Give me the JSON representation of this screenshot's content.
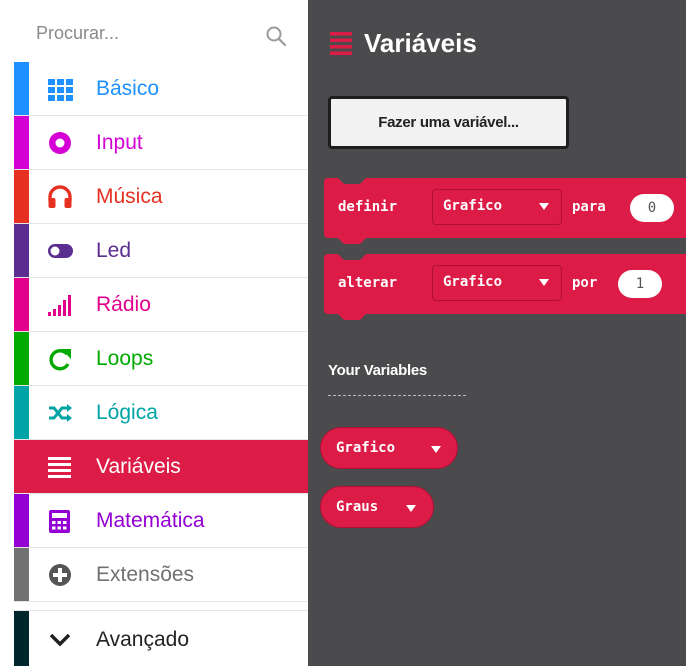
{
  "search": {
    "placeholder": "Procurar..."
  },
  "categories": [
    {
      "label": "Básico",
      "color": "#1e90ff",
      "icon": "grid-icon"
    },
    {
      "label": "Input",
      "color": "#d400d4",
      "icon": "target-icon"
    },
    {
      "label": "Música",
      "color": "#e63022",
      "icon": "headphones-icon"
    },
    {
      "label": "Led",
      "color": "#5c2d91",
      "icon": "toggle-icon"
    },
    {
      "label": "Rádio",
      "color": "#e3008c",
      "icon": "signal-icon"
    },
    {
      "label": "Loops",
      "color": "#00aa00",
      "icon": "loop-icon"
    },
    {
      "label": "Lógica",
      "color": "#00a4a6",
      "icon": "shuffle-icon"
    },
    {
      "label": "Variáveis",
      "color": "#dc143c",
      "icon": "lines-icon",
      "active": true
    },
    {
      "label": "Matemática",
      "color": "#9400d3",
      "icon": "calculator-icon"
    },
    {
      "label": "Extensões",
      "color": "#717171",
      "icon": "plus-circle-icon"
    },
    {
      "label": "Avançado",
      "color": "#00272b",
      "icon": "chevron-down-icon"
    }
  ],
  "flyout": {
    "title": "Variáveis",
    "make_variable": "Fazer uma variável...",
    "blocks": [
      {
        "kw1": "definir",
        "var": "Grafico",
        "kw2": "para",
        "value": "0"
      },
      {
        "kw1": "alterar",
        "var": "Grafico",
        "kw2": "por",
        "value": "1"
      }
    ],
    "your_variables": "Your Variables",
    "variables": [
      "Grafico",
      "Graus"
    ]
  }
}
